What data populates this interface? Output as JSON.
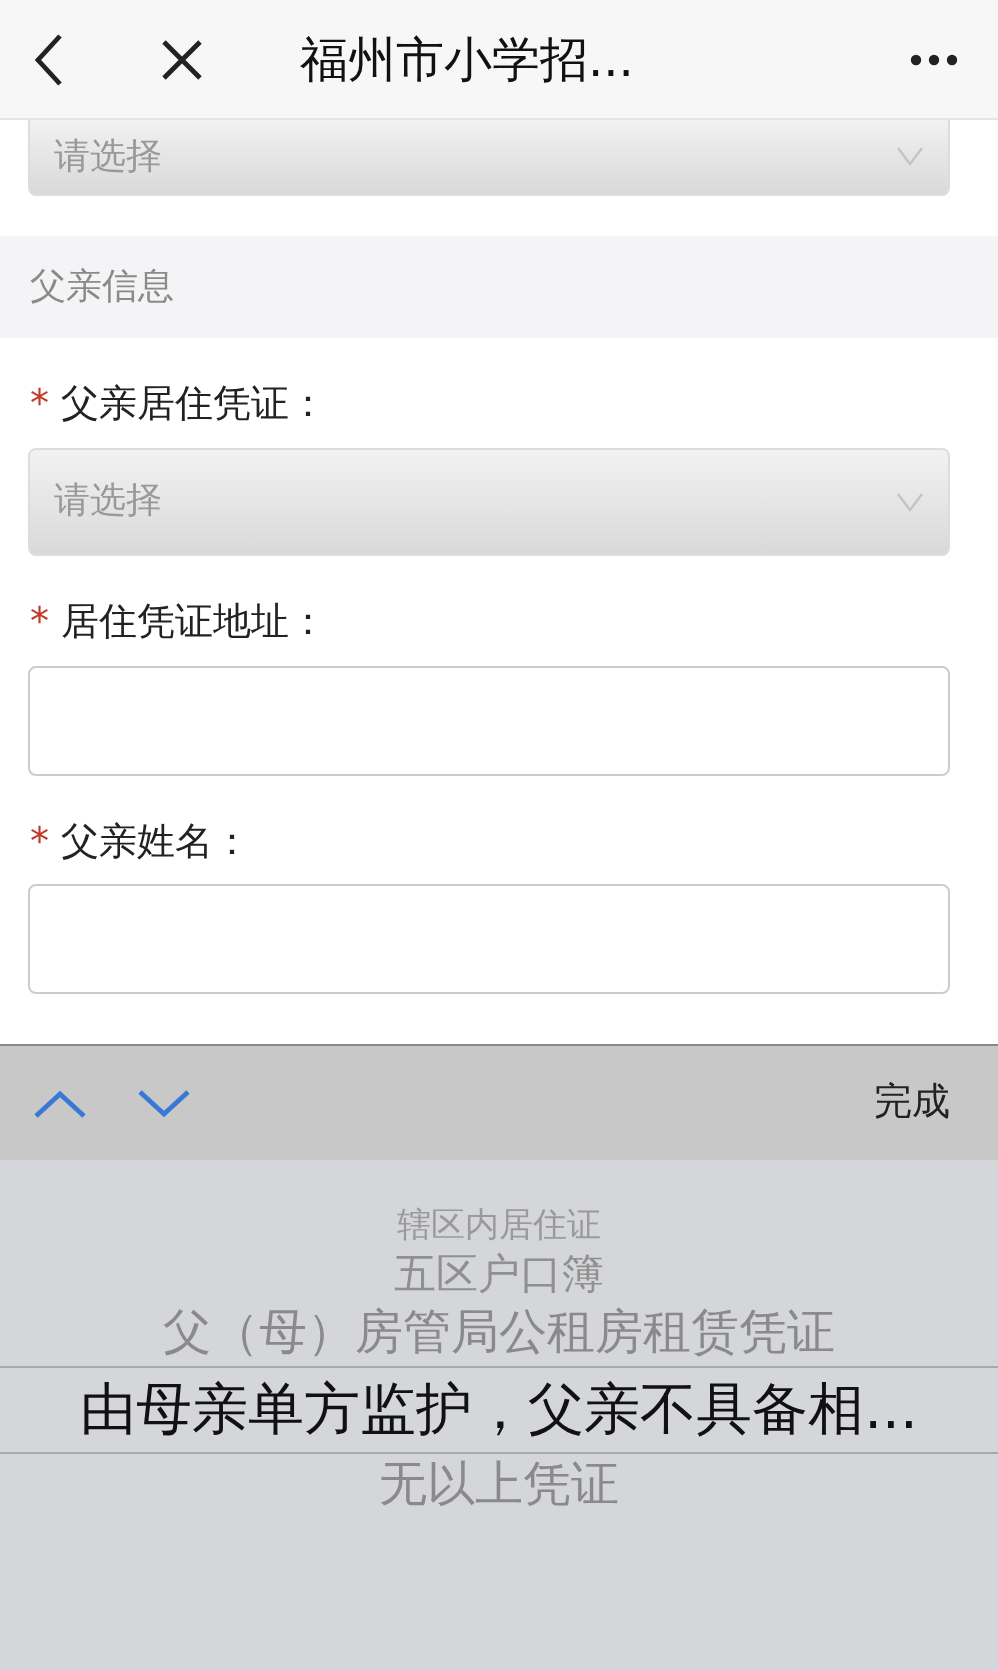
{
  "nav": {
    "title": "福州市小学招..."
  },
  "form": {
    "top_select": {
      "placeholder": "请选择"
    },
    "section": "父亲信息",
    "fields": [
      {
        "kind": "select",
        "required_mark": "*",
        "label": "父亲居住凭证：",
        "placeholder": "请选择"
      },
      {
        "kind": "input",
        "required_mark": "*",
        "label": "居住凭证地址："
      },
      {
        "kind": "input",
        "required_mark": "*",
        "label": "父亲姓名："
      }
    ]
  },
  "picker": {
    "done": "完成",
    "options": [
      {
        "label": "辖区内居住证",
        "selected": false
      },
      {
        "label": "五区户口簿",
        "selected": false
      },
      {
        "label": "父（母）房管局公租房租赁凭证",
        "selected": false
      },
      {
        "label": "由母亲单方监护，父亲不具备相...",
        "selected": true
      },
      {
        "label": "无以上凭证",
        "selected": false
      }
    ]
  }
}
